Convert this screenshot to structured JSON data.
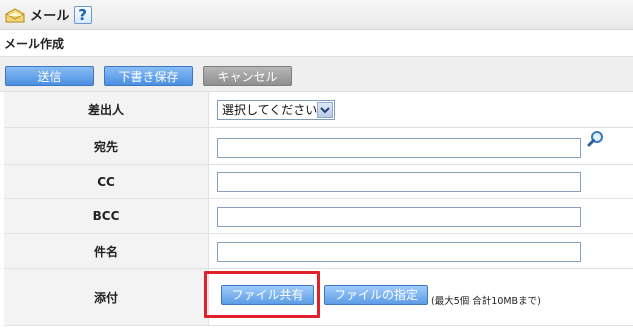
{
  "app": {
    "title": "メール",
    "help_icon": "?"
  },
  "section": {
    "title": "メール作成"
  },
  "toolbar": {
    "send_label": "送信",
    "draft_label": "下書き保存",
    "cancel_label": "キャンセル"
  },
  "form": {
    "sender": {
      "label": "差出人",
      "selected_value": "選択してください。"
    },
    "to": {
      "label": "宛先",
      "value": ""
    },
    "cc": {
      "label": "CC",
      "value": ""
    },
    "bcc": {
      "label": "BCC",
      "value": ""
    },
    "subject": {
      "label": "件名",
      "value": ""
    },
    "attachment": {
      "label": "添付",
      "file_share_label": "ファイル共有",
      "file_select_label": "ファイルの指定",
      "note": "(最大5個 合計10MBまで)"
    }
  },
  "icons": {
    "mail": "mail-icon",
    "help": "help-icon",
    "search": "search-icon",
    "dropdown": "chevron-down-icon"
  },
  "colors": {
    "primary_button": "#4b8fe0",
    "cancel_button": "#8f8f8f",
    "highlight": "#e0202a"
  }
}
